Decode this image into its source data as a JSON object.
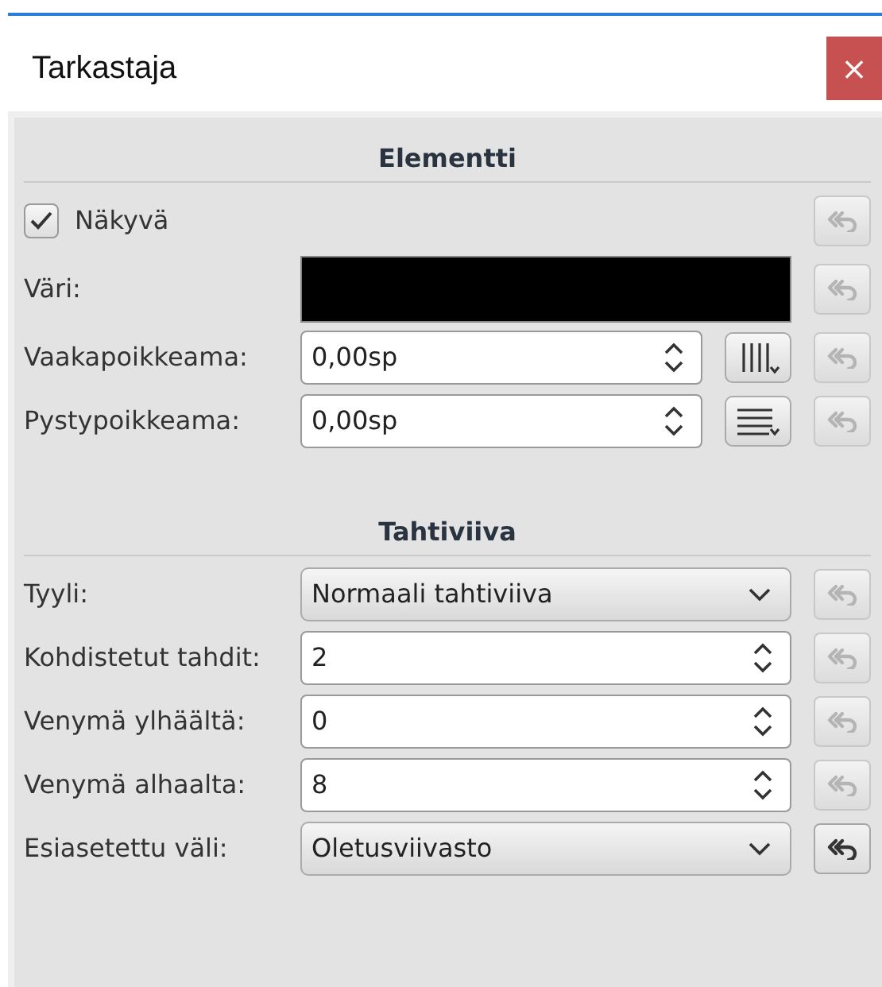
{
  "window": {
    "title": "Tarkastaja",
    "close": "×"
  },
  "sections": [
    {
      "title": "Elementti",
      "rows": [
        {
          "kind": "checkbox",
          "label": "Näkyvä",
          "checked": true,
          "reset_disabled": true
        },
        {
          "kind": "color",
          "label": "Väri:",
          "color": "#000000",
          "reset_disabled": true
        },
        {
          "kind": "spin",
          "label": "Vaakapoikkeama:",
          "value": "0,00sp",
          "tool": {
            "kind": "columns"
          },
          "reset_disabled": true
        },
        {
          "kind": "spin",
          "label": "Pystypoikkeama:",
          "value": "0,00sp",
          "tool": {
            "kind": "rows"
          },
          "reset_disabled": true
        }
      ]
    },
    {
      "title": "Tahtiviiva",
      "rows": [
        {
          "kind": "select",
          "label": "Tyyli:",
          "value": "Normaali tahtiviiva",
          "reset_disabled": true
        },
        {
          "kind": "spin",
          "label": "Kohdistetut tahdit:",
          "value": "2",
          "reset_disabled": true
        },
        {
          "kind": "spin",
          "label": "Venymä ylhäältä:",
          "value": "0",
          "reset_disabled": true
        },
        {
          "kind": "spin",
          "label": "Venymä alhaalta:",
          "value": "8",
          "reset_disabled": true
        },
        {
          "kind": "select",
          "label": "Esiasetettu väli:",
          "value": "Oletusviivasto",
          "reset_disabled": false
        }
      ]
    }
  ]
}
